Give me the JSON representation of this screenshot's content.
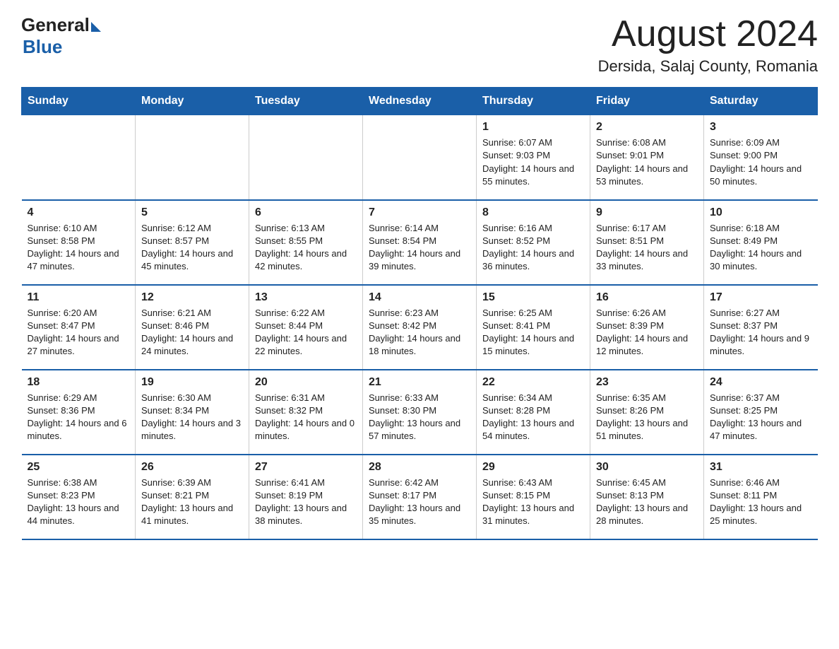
{
  "logo": {
    "general": "General",
    "blue": "Blue"
  },
  "title": "August 2024",
  "subtitle": "Dersida, Salaj County, Romania",
  "days_of_week": [
    "Sunday",
    "Monday",
    "Tuesday",
    "Wednesday",
    "Thursday",
    "Friday",
    "Saturday"
  ],
  "weeks": [
    [
      {
        "day": "",
        "info": ""
      },
      {
        "day": "",
        "info": ""
      },
      {
        "day": "",
        "info": ""
      },
      {
        "day": "",
        "info": ""
      },
      {
        "day": "1",
        "info": "Sunrise: 6:07 AM\nSunset: 9:03 PM\nDaylight: 14 hours and 55 minutes."
      },
      {
        "day": "2",
        "info": "Sunrise: 6:08 AM\nSunset: 9:01 PM\nDaylight: 14 hours and 53 minutes."
      },
      {
        "day": "3",
        "info": "Sunrise: 6:09 AM\nSunset: 9:00 PM\nDaylight: 14 hours and 50 minutes."
      }
    ],
    [
      {
        "day": "4",
        "info": "Sunrise: 6:10 AM\nSunset: 8:58 PM\nDaylight: 14 hours and 47 minutes."
      },
      {
        "day": "5",
        "info": "Sunrise: 6:12 AM\nSunset: 8:57 PM\nDaylight: 14 hours and 45 minutes."
      },
      {
        "day": "6",
        "info": "Sunrise: 6:13 AM\nSunset: 8:55 PM\nDaylight: 14 hours and 42 minutes."
      },
      {
        "day": "7",
        "info": "Sunrise: 6:14 AM\nSunset: 8:54 PM\nDaylight: 14 hours and 39 minutes."
      },
      {
        "day": "8",
        "info": "Sunrise: 6:16 AM\nSunset: 8:52 PM\nDaylight: 14 hours and 36 minutes."
      },
      {
        "day": "9",
        "info": "Sunrise: 6:17 AM\nSunset: 8:51 PM\nDaylight: 14 hours and 33 minutes."
      },
      {
        "day": "10",
        "info": "Sunrise: 6:18 AM\nSunset: 8:49 PM\nDaylight: 14 hours and 30 minutes."
      }
    ],
    [
      {
        "day": "11",
        "info": "Sunrise: 6:20 AM\nSunset: 8:47 PM\nDaylight: 14 hours and 27 minutes."
      },
      {
        "day": "12",
        "info": "Sunrise: 6:21 AM\nSunset: 8:46 PM\nDaylight: 14 hours and 24 minutes."
      },
      {
        "day": "13",
        "info": "Sunrise: 6:22 AM\nSunset: 8:44 PM\nDaylight: 14 hours and 22 minutes."
      },
      {
        "day": "14",
        "info": "Sunrise: 6:23 AM\nSunset: 8:42 PM\nDaylight: 14 hours and 18 minutes."
      },
      {
        "day": "15",
        "info": "Sunrise: 6:25 AM\nSunset: 8:41 PM\nDaylight: 14 hours and 15 minutes."
      },
      {
        "day": "16",
        "info": "Sunrise: 6:26 AM\nSunset: 8:39 PM\nDaylight: 14 hours and 12 minutes."
      },
      {
        "day": "17",
        "info": "Sunrise: 6:27 AM\nSunset: 8:37 PM\nDaylight: 14 hours and 9 minutes."
      }
    ],
    [
      {
        "day": "18",
        "info": "Sunrise: 6:29 AM\nSunset: 8:36 PM\nDaylight: 14 hours and 6 minutes."
      },
      {
        "day": "19",
        "info": "Sunrise: 6:30 AM\nSunset: 8:34 PM\nDaylight: 14 hours and 3 minutes."
      },
      {
        "day": "20",
        "info": "Sunrise: 6:31 AM\nSunset: 8:32 PM\nDaylight: 14 hours and 0 minutes."
      },
      {
        "day": "21",
        "info": "Sunrise: 6:33 AM\nSunset: 8:30 PM\nDaylight: 13 hours and 57 minutes."
      },
      {
        "day": "22",
        "info": "Sunrise: 6:34 AM\nSunset: 8:28 PM\nDaylight: 13 hours and 54 minutes."
      },
      {
        "day": "23",
        "info": "Sunrise: 6:35 AM\nSunset: 8:26 PM\nDaylight: 13 hours and 51 minutes."
      },
      {
        "day": "24",
        "info": "Sunrise: 6:37 AM\nSunset: 8:25 PM\nDaylight: 13 hours and 47 minutes."
      }
    ],
    [
      {
        "day": "25",
        "info": "Sunrise: 6:38 AM\nSunset: 8:23 PM\nDaylight: 13 hours and 44 minutes."
      },
      {
        "day": "26",
        "info": "Sunrise: 6:39 AM\nSunset: 8:21 PM\nDaylight: 13 hours and 41 minutes."
      },
      {
        "day": "27",
        "info": "Sunrise: 6:41 AM\nSunset: 8:19 PM\nDaylight: 13 hours and 38 minutes."
      },
      {
        "day": "28",
        "info": "Sunrise: 6:42 AM\nSunset: 8:17 PM\nDaylight: 13 hours and 35 minutes."
      },
      {
        "day": "29",
        "info": "Sunrise: 6:43 AM\nSunset: 8:15 PM\nDaylight: 13 hours and 31 minutes."
      },
      {
        "day": "30",
        "info": "Sunrise: 6:45 AM\nSunset: 8:13 PM\nDaylight: 13 hours and 28 minutes."
      },
      {
        "day": "31",
        "info": "Sunrise: 6:46 AM\nSunset: 8:11 PM\nDaylight: 13 hours and 25 minutes."
      }
    ]
  ]
}
